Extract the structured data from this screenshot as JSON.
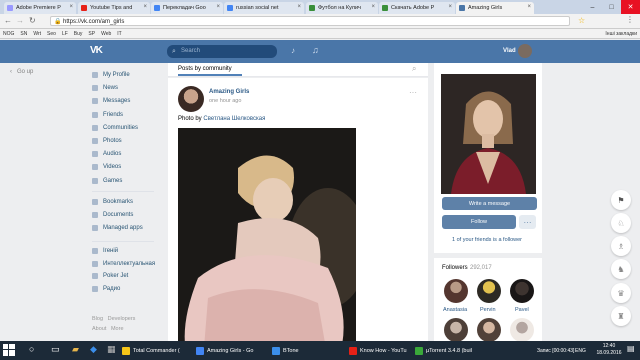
{
  "browser": {
    "tabs": [
      {
        "label": "Adobe Premiere P",
        "color": "#9999ff"
      },
      {
        "label": "Youtube Tips and",
        "color": "#e62117"
      },
      {
        "label": "Перекладач Goo",
        "color": "#4285f4"
      },
      {
        "label": "russian social net",
        "color": "#4285f4"
      },
      {
        "label": "Футбол на Кулич",
        "color": "#3a8f3a"
      },
      {
        "label": "Скачать Adobe P",
        "color": "#3a8f3a"
      },
      {
        "label": "Amazing Girls",
        "color": "#4a76a8"
      }
    ],
    "url": "https://vk.com/am_girls",
    "bookmarks": [
      "NOG",
      "SN",
      "Wrt",
      "Seo",
      "LF",
      "Buy",
      "SP",
      "Web",
      "IT"
    ],
    "other_bookmarks": "Інші закладки"
  },
  "vk": {
    "search_placeholder": "Search",
    "user_name": "Vlad",
    "go_up": "Go up",
    "menu_main": [
      "My Profile",
      "News",
      "Messages",
      "Friends",
      "Communities",
      "Photos",
      "Audios",
      "Videos",
      "Games"
    ],
    "menu_secondary": [
      "Bookmarks",
      "Documents",
      "Managed apps"
    ],
    "menu_apps": [
      "Ігеній",
      "Интеллектуальная",
      "Poker Jet",
      "Радио"
    ],
    "footer": [
      "Blog",
      "Developers",
      "About",
      "More"
    ],
    "feed_tab": "Posts by community",
    "post": {
      "author": "Amazing Girls",
      "time": "one hour ago",
      "caption_prefix": "Photo by",
      "caption_author": "Светлана Шелковская"
    },
    "card": {
      "write_message": "Write a message",
      "follow": "Follow",
      "friends_note": "1 of your friends is a follower"
    },
    "followers": {
      "label": "Followers",
      "count": "292,017",
      "people": [
        "Anastasia",
        "Pervin",
        "Pavel"
      ]
    }
  },
  "taskbar": {
    "items": [
      {
        "label": "Total Commander (",
        "color": "#f5c518"
      },
      {
        "label": "Amazing Girls - Go",
        "color": "#4285f4"
      },
      {
        "label": "BTone",
        "color": "#3b8eea"
      },
      {
        "label": "Know How - YouTu",
        "color": "#e62117"
      },
      {
        "label": "µTorrent 3.4.8 (buil",
        "color": "#3aa93a"
      }
    ],
    "notification": "Запис [00:00:43]",
    "lang": "ENG",
    "time": "12:40",
    "date": "18.09.2016"
  }
}
